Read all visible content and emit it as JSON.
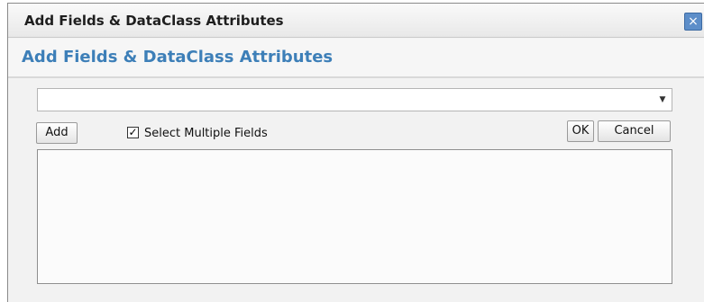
{
  "window": {
    "title": "Add Fields & DataClass Attributes",
    "close_icon": "×"
  },
  "header": {
    "title": "Add Fields & DataClass Attributes"
  },
  "combo": {
    "value": "",
    "arrow_icon": "▼"
  },
  "toolbar": {
    "add_label": "Add",
    "select_multiple_label": "Select Multiple Fields",
    "select_multiple_checked": true,
    "check_mark": "✓",
    "ok_label": "OK",
    "cancel_label": "Cancel"
  },
  "list": {
    "items": []
  },
  "colors": {
    "accent": "#3d7fb8",
    "close_button": "#5d8ec9"
  }
}
